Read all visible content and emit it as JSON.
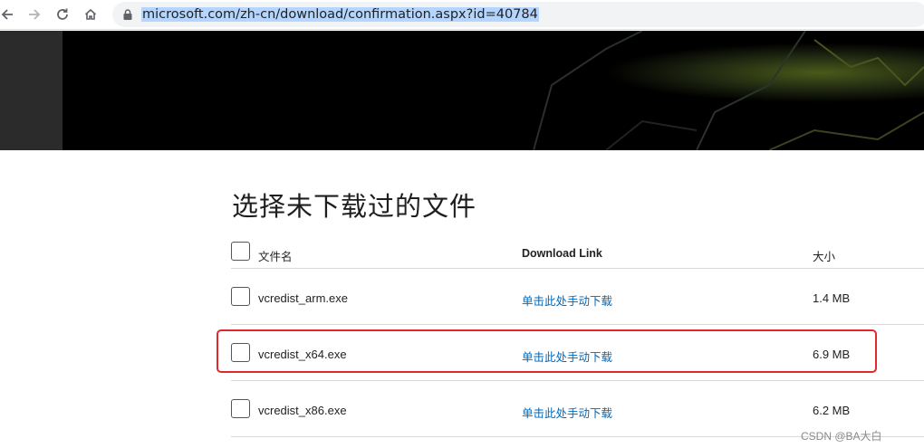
{
  "browser": {
    "url": "microsoft.com/zh-cn/download/confirmation.aspx?id=40784",
    "icons": [
      "back-arrow-icon",
      "forward-arrow-icon",
      "reload-icon",
      "home-icon",
      "lock-icon"
    ]
  },
  "page": {
    "title": "选择未下载过的文件",
    "columns": {
      "name": "文件名",
      "link": "Download Link",
      "size": "大小"
    },
    "files": [
      {
        "name": "vcredist_arm.exe",
        "link": "单击此处手动下载",
        "size": "1.4 MB"
      },
      {
        "name": "vcredist_x64.exe",
        "link": "单击此处手动下载",
        "size": "6.9 MB"
      },
      {
        "name": "vcredist_x86.exe",
        "link": "单击此处手动下载",
        "size": "6.2 MB"
      }
    ]
  },
  "annotation": {
    "color": "#e0282e"
  },
  "watermark": "CSDN @BA大白"
}
